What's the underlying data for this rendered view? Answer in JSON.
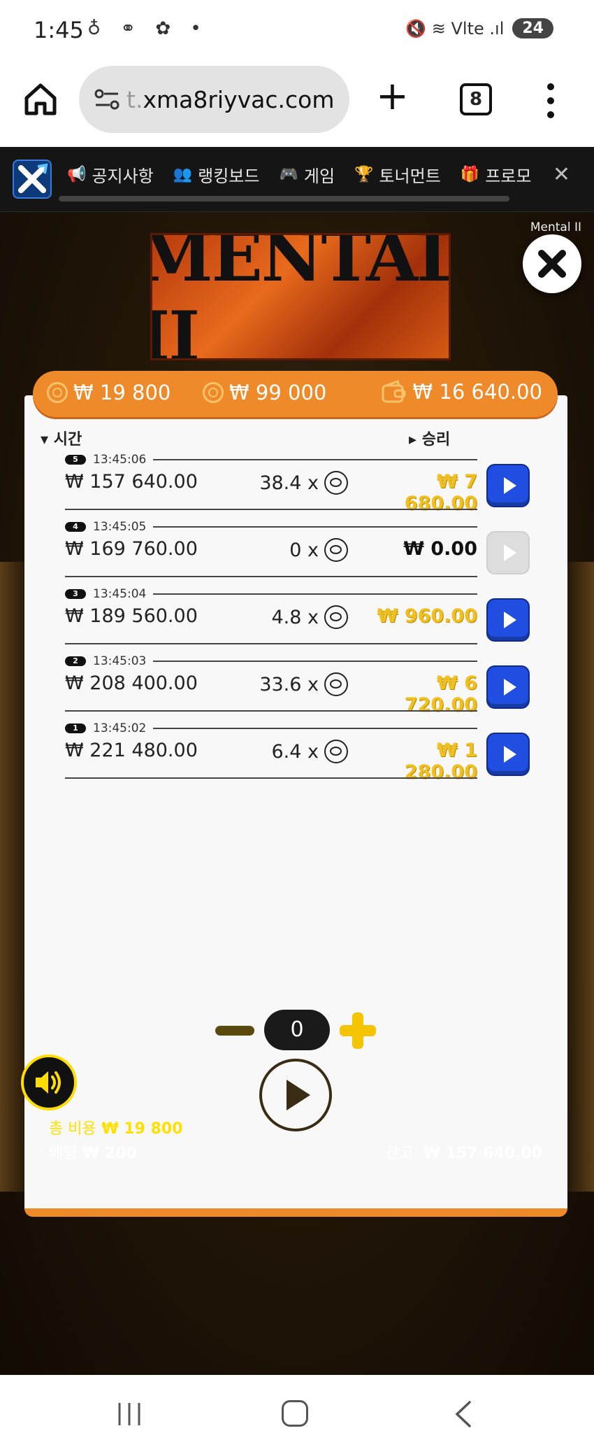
{
  "status_bar": {
    "time": "1:45",
    "left_icons": "♁ ⚭ ✿ •",
    "right_icons": "🔇 ≋ Vlte .ıl",
    "battery": "24"
  },
  "browser": {
    "url_faded": "t.",
    "url": "xma8riyvac.com",
    "tab_count": "8"
  },
  "site_nav": {
    "items": [
      {
        "icon": "megaphone-icon",
        "glyph": "📢",
        "label": "공지사항"
      },
      {
        "icon": "users-icon",
        "glyph": "👥",
        "label": "랭킹보드"
      },
      {
        "icon": "gamepad-icon",
        "glyph": "🎮",
        "label": "게임"
      },
      {
        "icon": "trophy-icon",
        "glyph": "🏆",
        "label": "토너먼트"
      },
      {
        "icon": "gift-icon",
        "glyph": "🎁",
        "label": "프로모"
      }
    ],
    "close_glyph": "✕"
  },
  "game": {
    "logo_text": "MENTAL II",
    "label": "Mental II",
    "accent_color": "#ee8a2a"
  },
  "history_panel": {
    "header": {
      "cost": "₩ 19 800",
      "total": "₩ 99 000",
      "win_total": "₩ 16 640.00"
    },
    "columns": {
      "time": "▾ 시간",
      "win": "▸ 승리"
    },
    "rows": [
      {
        "round": "5",
        "time": "13:45:06",
        "balance": "₩ 157 640.00",
        "multiplier": "38.4 x",
        "win": "₩ 7 680.00",
        "replay_enabled": true
      },
      {
        "round": "4",
        "time": "13:45:05",
        "balance": "₩ 169 760.00",
        "multiplier": "0 x",
        "win": "₩ 0.00",
        "replay_enabled": false
      },
      {
        "round": "3",
        "time": "13:45:04",
        "balance": "₩ 189 560.00",
        "multiplier": "4.8 x",
        "win": "₩ 960.00",
        "replay_enabled": true
      },
      {
        "round": "2",
        "time": "13:45:03",
        "balance": "₩ 208 400.00",
        "multiplier": "33.6 x",
        "win": "₩ 6 720.00",
        "replay_enabled": true
      },
      {
        "round": "1",
        "time": "13:45:02",
        "balance": "₩ 221 480.00",
        "multiplier": "6.4 x",
        "win": "₩ 1 280.00",
        "replay_enabled": true
      }
    ]
  },
  "controls": {
    "bet_value": "0",
    "total_cost_label": "총 비용",
    "total_cost_value": "₩ 19 800",
    "bet_label": "베팅",
    "bet_amount": "₩ 200",
    "balance_label": "잔고",
    "balance_value": "₩ 157 640.00"
  }
}
